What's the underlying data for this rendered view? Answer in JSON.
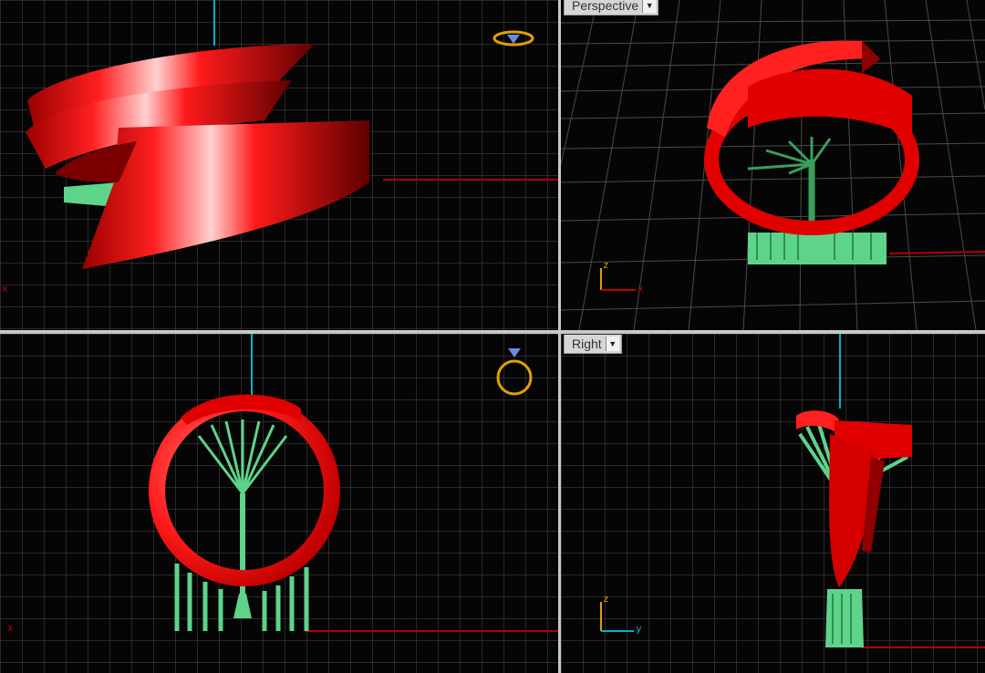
{
  "viewports": {
    "top": {
      "name": ""
    },
    "perspective": {
      "name": "Perspective",
      "menu_icon": "triangle-down-icon"
    },
    "front": {
      "name": ""
    },
    "right": {
      "name": "Right",
      "menu_icon": "triangle-down-icon"
    }
  },
  "axis_labels": {
    "top_x": "x",
    "persp_z": "z",
    "persp_x": "x",
    "front_x": "x",
    "right_z": "z",
    "right_y": "y"
  },
  "colors": {
    "background": "#050505",
    "grid": "#4a4a4a",
    "grid_major": "#7a7a7a",
    "ring": "#e00000",
    "support": "#5ed38a",
    "axis_red": "#b00000",
    "axis_cyan": "#00b4c8",
    "gizmo": "#e0a000"
  }
}
